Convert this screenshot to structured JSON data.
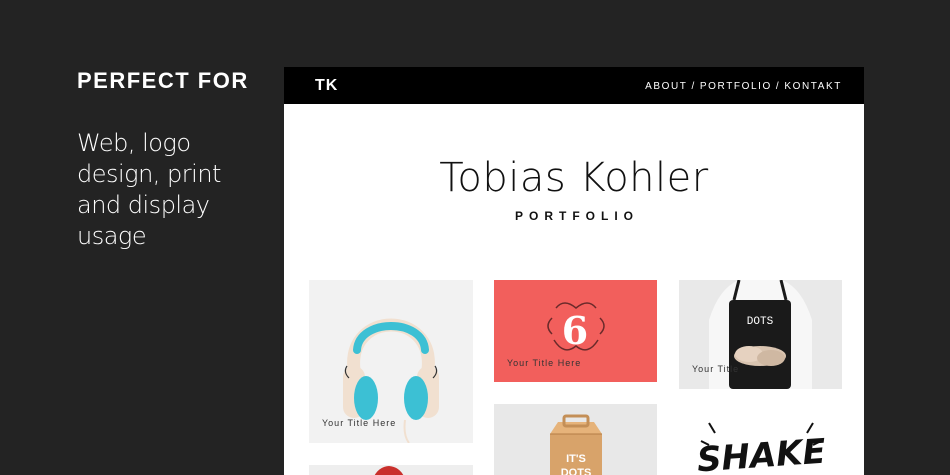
{
  "promo": {
    "heading": "PERFECT FOR",
    "text": "Web, logo design, print and display usage"
  },
  "site": {
    "logo": "TK",
    "nav": [
      "ABOUT",
      "PORTFOLIO",
      "KONTAKT"
    ],
    "nav_separator": "/",
    "name": "Tobias Kohler",
    "subtitle": "PORTFOLIO"
  },
  "portfolio": {
    "items": [
      {
        "caption": "Your Title Here",
        "image": "headphones"
      },
      {
        "caption": "Your Title Here",
        "image": "number-six-ornament",
        "badge": "6"
      },
      {
        "caption": "Your Title",
        "image": "person-in-dots-apron",
        "apron_text": "DOTS"
      },
      {
        "caption": "",
        "image": "dots-box",
        "box_text": "IT'S\nDOTS"
      },
      {
        "caption": "",
        "image": "shake-lettering",
        "lettering": "SHAKE"
      },
      {
        "caption": "",
        "image": "red-object"
      }
    ]
  },
  "colors": {
    "background": "#232323",
    "site_header": "#000000",
    "coral": "#f25f5c",
    "headphone_accent": "#3cc0d4"
  }
}
